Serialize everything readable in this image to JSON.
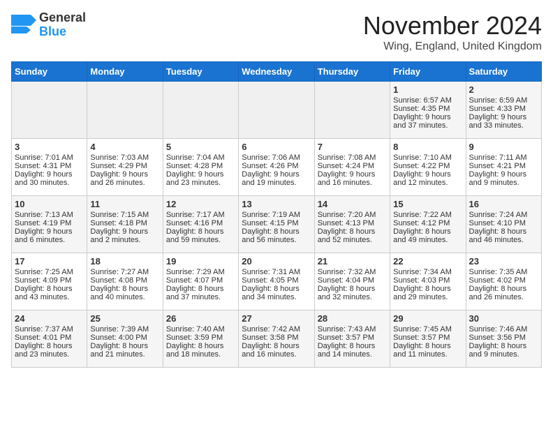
{
  "header": {
    "logo_general": "General",
    "logo_blue": "Blue",
    "month_title": "November 2024",
    "location": "Wing, England, United Kingdom"
  },
  "days_of_week": [
    "Sunday",
    "Monday",
    "Tuesday",
    "Wednesday",
    "Thursday",
    "Friday",
    "Saturday"
  ],
  "weeks": [
    [
      {
        "day": "",
        "lines": []
      },
      {
        "day": "",
        "lines": []
      },
      {
        "day": "",
        "lines": []
      },
      {
        "day": "",
        "lines": []
      },
      {
        "day": "",
        "lines": []
      },
      {
        "day": "1",
        "lines": [
          "Sunrise: 6:57 AM",
          "Sunset: 4:35 PM",
          "Daylight: 9 hours",
          "and 37 minutes."
        ]
      },
      {
        "day": "2",
        "lines": [
          "Sunrise: 6:59 AM",
          "Sunset: 4:33 PM",
          "Daylight: 9 hours",
          "and 33 minutes."
        ]
      }
    ],
    [
      {
        "day": "3",
        "lines": [
          "Sunrise: 7:01 AM",
          "Sunset: 4:31 PM",
          "Daylight: 9 hours",
          "and 30 minutes."
        ]
      },
      {
        "day": "4",
        "lines": [
          "Sunrise: 7:03 AM",
          "Sunset: 4:29 PM",
          "Daylight: 9 hours",
          "and 26 minutes."
        ]
      },
      {
        "day": "5",
        "lines": [
          "Sunrise: 7:04 AM",
          "Sunset: 4:28 PM",
          "Daylight: 9 hours",
          "and 23 minutes."
        ]
      },
      {
        "day": "6",
        "lines": [
          "Sunrise: 7:06 AM",
          "Sunset: 4:26 PM",
          "Daylight: 9 hours",
          "and 19 minutes."
        ]
      },
      {
        "day": "7",
        "lines": [
          "Sunrise: 7:08 AM",
          "Sunset: 4:24 PM",
          "Daylight: 9 hours",
          "and 16 minutes."
        ]
      },
      {
        "day": "8",
        "lines": [
          "Sunrise: 7:10 AM",
          "Sunset: 4:22 PM",
          "Daylight: 9 hours",
          "and 12 minutes."
        ]
      },
      {
        "day": "9",
        "lines": [
          "Sunrise: 7:11 AM",
          "Sunset: 4:21 PM",
          "Daylight: 9 hours",
          "and 9 minutes."
        ]
      }
    ],
    [
      {
        "day": "10",
        "lines": [
          "Sunrise: 7:13 AM",
          "Sunset: 4:19 PM",
          "Daylight: 9 hours",
          "and 6 minutes."
        ]
      },
      {
        "day": "11",
        "lines": [
          "Sunrise: 7:15 AM",
          "Sunset: 4:18 PM",
          "Daylight: 9 hours",
          "and 2 minutes."
        ]
      },
      {
        "day": "12",
        "lines": [
          "Sunrise: 7:17 AM",
          "Sunset: 4:16 PM",
          "Daylight: 8 hours",
          "and 59 minutes."
        ]
      },
      {
        "day": "13",
        "lines": [
          "Sunrise: 7:19 AM",
          "Sunset: 4:15 PM",
          "Daylight: 8 hours",
          "and 56 minutes."
        ]
      },
      {
        "day": "14",
        "lines": [
          "Sunrise: 7:20 AM",
          "Sunset: 4:13 PM",
          "Daylight: 8 hours",
          "and 52 minutes."
        ]
      },
      {
        "day": "15",
        "lines": [
          "Sunrise: 7:22 AM",
          "Sunset: 4:12 PM",
          "Daylight: 8 hours",
          "and 49 minutes."
        ]
      },
      {
        "day": "16",
        "lines": [
          "Sunrise: 7:24 AM",
          "Sunset: 4:10 PM",
          "Daylight: 8 hours",
          "and 46 minutes."
        ]
      }
    ],
    [
      {
        "day": "17",
        "lines": [
          "Sunrise: 7:25 AM",
          "Sunset: 4:09 PM",
          "Daylight: 8 hours",
          "and 43 minutes."
        ]
      },
      {
        "day": "18",
        "lines": [
          "Sunrise: 7:27 AM",
          "Sunset: 4:08 PM",
          "Daylight: 8 hours",
          "and 40 minutes."
        ]
      },
      {
        "day": "19",
        "lines": [
          "Sunrise: 7:29 AM",
          "Sunset: 4:07 PM",
          "Daylight: 8 hours",
          "and 37 minutes."
        ]
      },
      {
        "day": "20",
        "lines": [
          "Sunrise: 7:31 AM",
          "Sunset: 4:05 PM",
          "Daylight: 8 hours",
          "and 34 minutes."
        ]
      },
      {
        "day": "21",
        "lines": [
          "Sunrise: 7:32 AM",
          "Sunset: 4:04 PM",
          "Daylight: 8 hours",
          "and 32 minutes."
        ]
      },
      {
        "day": "22",
        "lines": [
          "Sunrise: 7:34 AM",
          "Sunset: 4:03 PM",
          "Daylight: 8 hours",
          "and 29 minutes."
        ]
      },
      {
        "day": "23",
        "lines": [
          "Sunrise: 7:35 AM",
          "Sunset: 4:02 PM",
          "Daylight: 8 hours",
          "and 26 minutes."
        ]
      }
    ],
    [
      {
        "day": "24",
        "lines": [
          "Sunrise: 7:37 AM",
          "Sunset: 4:01 PM",
          "Daylight: 8 hours",
          "and 23 minutes."
        ]
      },
      {
        "day": "25",
        "lines": [
          "Sunrise: 7:39 AM",
          "Sunset: 4:00 PM",
          "Daylight: 8 hours",
          "and 21 minutes."
        ]
      },
      {
        "day": "26",
        "lines": [
          "Sunrise: 7:40 AM",
          "Sunset: 3:59 PM",
          "Daylight: 8 hours",
          "and 18 minutes."
        ]
      },
      {
        "day": "27",
        "lines": [
          "Sunrise: 7:42 AM",
          "Sunset: 3:58 PM",
          "Daylight: 8 hours",
          "and 16 minutes."
        ]
      },
      {
        "day": "28",
        "lines": [
          "Sunrise: 7:43 AM",
          "Sunset: 3:57 PM",
          "Daylight: 8 hours",
          "and 14 minutes."
        ]
      },
      {
        "day": "29",
        "lines": [
          "Sunrise: 7:45 AM",
          "Sunset: 3:57 PM",
          "Daylight: 8 hours",
          "and 11 minutes."
        ]
      },
      {
        "day": "30",
        "lines": [
          "Sunrise: 7:46 AM",
          "Sunset: 3:56 PM",
          "Daylight: 8 hours",
          "and 9 minutes."
        ]
      }
    ]
  ]
}
